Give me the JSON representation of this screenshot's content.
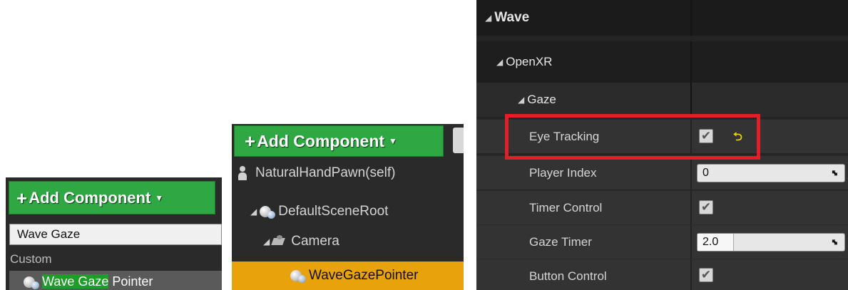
{
  "panel1": {
    "add_button": {
      "plus": "+",
      "label": "Add Component",
      "caret": "▼"
    },
    "search_value": "Wave Gaze",
    "category": "Custom",
    "result": {
      "highlight": "Wave Gaze",
      "rest": " Pointer"
    }
  },
  "panel2": {
    "add_button": {
      "plus": "+",
      "label": "Add Component",
      "caret": "▼"
    },
    "self_item": "NaturalHandPawn(self)",
    "tree": [
      {
        "label": "DefaultSceneRoot"
      },
      {
        "label": "Camera"
      }
    ],
    "selected_item": "WaveGazePointer"
  },
  "panel3": {
    "section_wave": "Wave",
    "section_openxr": "OpenXR",
    "section_gaze": "Gaze",
    "collapse_arrow": "◢",
    "properties": [
      {
        "name": "Eye Tracking",
        "type": "checkbox",
        "checked": true
      },
      {
        "name": "Player Index",
        "type": "number",
        "value": "0"
      },
      {
        "name": "Timer Control",
        "type": "checkbox",
        "checked": true
      },
      {
        "name": "Gaze Timer",
        "type": "number",
        "value": "2.0"
      },
      {
        "name": "Button Control",
        "type": "checkbox",
        "checked": true
      }
    ],
    "check_glyph": "✔",
    "reset_glyph": "⮌",
    "spin_glyph": "⬌"
  },
  "colors": {
    "add_button_green": "#2fa843",
    "selection_orange": "#e8a30c",
    "highlight_red": "#e21e26",
    "reset_yellow": "#f2d100"
  }
}
